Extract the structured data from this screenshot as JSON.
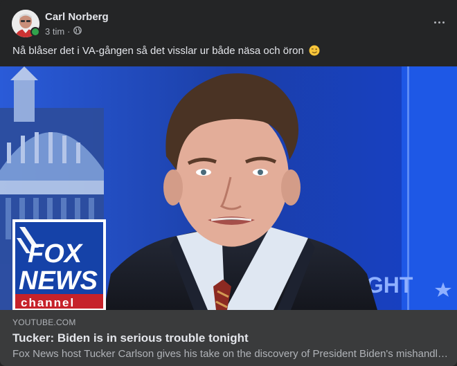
{
  "post": {
    "author": "Carl Norberg",
    "timestamp": "3 tim",
    "separator": "·",
    "audience_icon": "globe-icon",
    "menu_icon": "more-horizontal-icon",
    "text": "Nå blåser det i VA-gången så det visslar ur både näsa och öron",
    "emoji": "winking-face-emoji"
  },
  "thumbnail": {
    "logo_line1": "FOX",
    "logo_line2": "NEWS",
    "logo_line3": "channel",
    "background_text": "IGHT"
  },
  "link_preview": {
    "domain": "YOUTUBE.COM",
    "title": "Tucker: Biden is in serious trouble tonight",
    "description": "Fox News host Tucker Carlson gives his take on the discovery of President Biden's mishandled classified documents"
  },
  "colors": {
    "card_bg": "#242526",
    "link_bg": "#3a3b3c",
    "online": "#31a24c",
    "primary_text": "#e4e6eb",
    "secondary_text": "#b0b3b8"
  }
}
